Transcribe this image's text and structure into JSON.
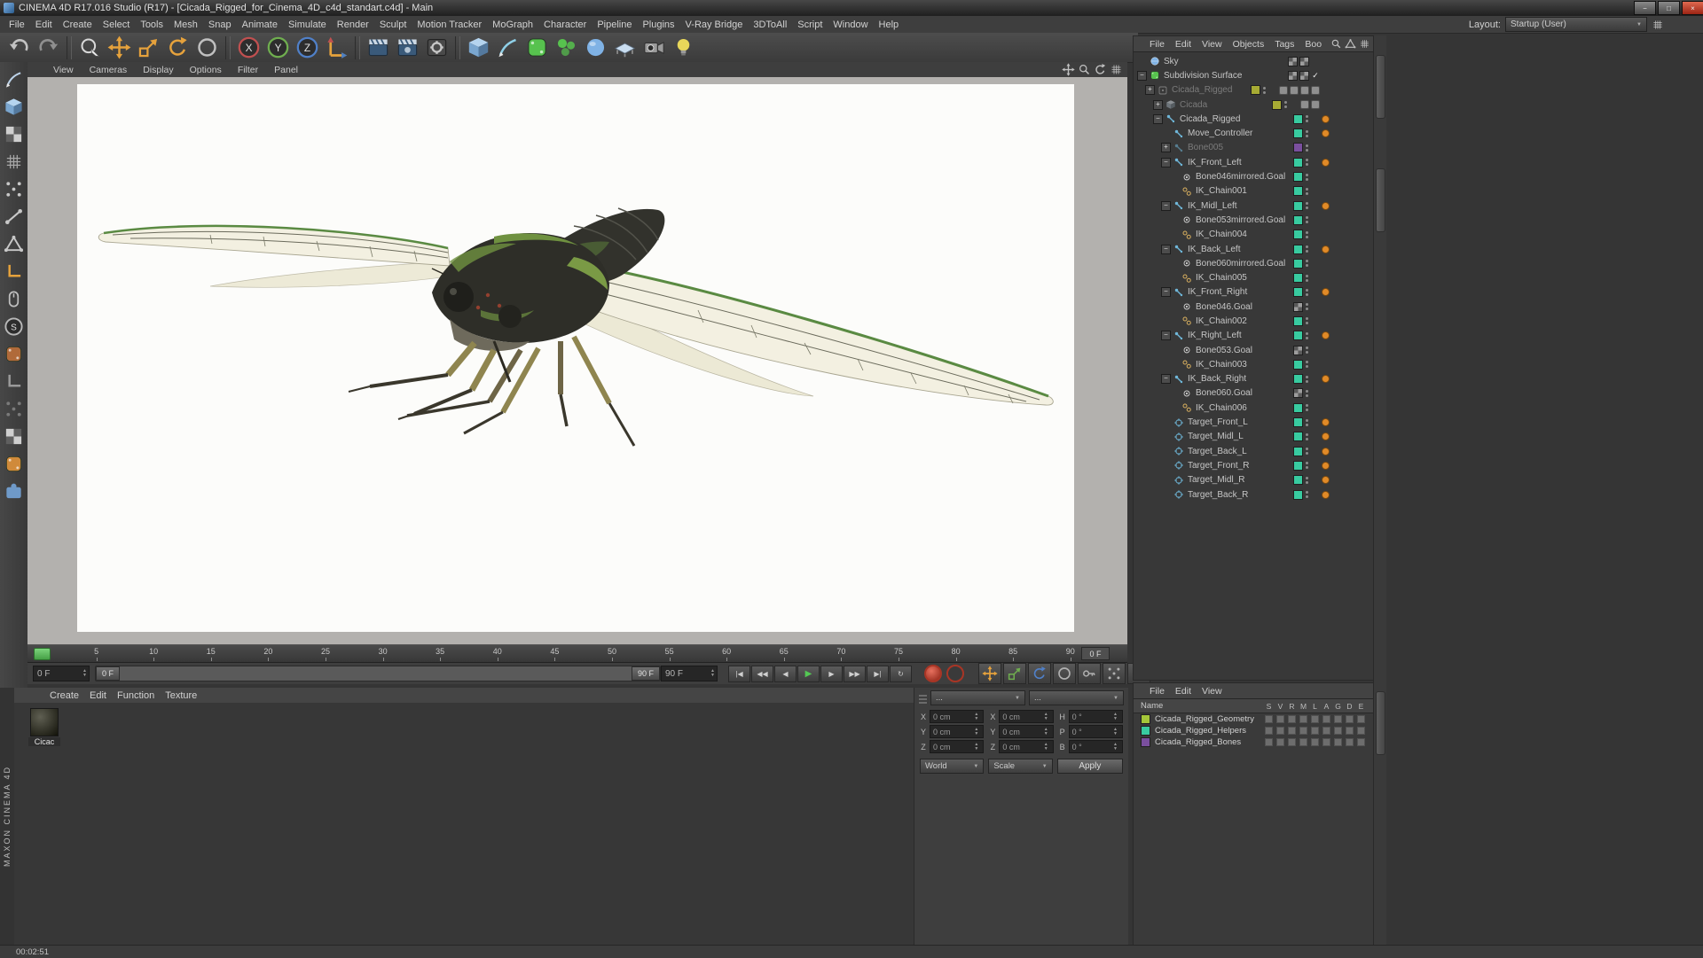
{
  "glyphs": {
    "up": "▲",
    "down": "▼",
    "dropdown": "▼"
  },
  "titlebar": {
    "title": "CINEMA 4D R17.016 Studio (R17) - [Cicada_Rigged_for_Cinema_4D_c4d_standart.c4d] - Main",
    "buttons": [
      {
        "name": "minimize-button",
        "glyph": "−"
      },
      {
        "name": "maximize-button",
        "glyph": "□"
      },
      {
        "name": "close-button",
        "glyph": "×"
      }
    ]
  },
  "menubar": {
    "items": [
      "File",
      "Edit",
      "Create",
      "Select",
      "Tools",
      "Mesh",
      "Snap",
      "Animate",
      "Simulate",
      "Render",
      "Sculpt",
      "Motion Tracker",
      "MoGraph",
      "Character",
      "Pipeline",
      "Plugins",
      "V-Ray Bridge",
      "3DToAll",
      "Script",
      "Window",
      "Help"
    ],
    "layout_label": "Layout:",
    "layout_value": "Startup (User)"
  },
  "toolbar": {
    "icons": [
      {
        "name": "undo-icon",
        "shape": "undo",
        "color": "#c2c2c2"
      },
      {
        "name": "redo-icon",
        "shape": "redo",
        "color": "#8f8f8f"
      },
      {
        "sep": true
      },
      {
        "name": "live-selection-icon",
        "shape": "select",
        "color": "#d8d8d8"
      },
      {
        "name": "move-tool-icon",
        "shape": "move",
        "color": "#e6a23c"
      },
      {
        "name": "scale-tool-icon",
        "shape": "scale",
        "color": "#e6a23c"
      },
      {
        "name": "rotate-tool-icon",
        "shape": "rotate",
        "color": "#e6a23c"
      },
      {
        "name": "last-tool-icon",
        "shape": "ring",
        "color": "#c0c0c0"
      },
      {
        "sep": true
      },
      {
        "name": "lock-x-axis-icon",
        "shape": "letter",
        "glyph": "X",
        "color": "#c05050"
      },
      {
        "name": "lock-y-axis-icon",
        "shape": "letter",
        "glyph": "Y",
        "color": "#6fae4f"
      },
      {
        "name": "lock-z-axis-icon",
        "shape": "letter",
        "glyph": "Z",
        "color": "#5080c8"
      },
      {
        "name": "coordinate-system-icon",
        "shape": "axes",
        "color": "#e6a23c"
      },
      {
        "sep": true
      },
      {
        "name": "render-view-icon",
        "shape": "clapper",
        "color": "#8fb3d9"
      },
      {
        "name": "render-picture-viewer-icon",
        "shape": "clapper2",
        "color": "#8fb3d9"
      },
      {
        "name": "render-settings-icon",
        "shape": "clapper3",
        "color": "#b0b0b0"
      },
      {
        "sep": true
      },
      {
        "name": "add-cube-icon",
        "shape": "cube",
        "color": "#7fb2e5"
      },
      {
        "name": "freehand-spline-icon",
        "shape": "pen",
        "color": "#8fd0e8"
      },
      {
        "name": "subdivision-surface-icon",
        "shape": "roundsq",
        "color": "#57c24e"
      },
      {
        "name": "mograph-icon",
        "shape": "sphere3",
        "color": "#57c24e"
      },
      {
        "name": "simulate-icon",
        "shape": "sphere",
        "color": "#7fb2e5"
      },
      {
        "name": "floor-icon",
        "shape": "floor",
        "color": "#c9ddf0"
      },
      {
        "name": "camera-icon",
        "shape": "camera",
        "color": "#9a9a9a"
      },
      {
        "name": "light-icon",
        "shape": "bulb",
        "color": "#e8d75a"
      }
    ]
  },
  "left_toolbar": [
    {
      "name": "make-editable-icon",
      "shape": "pen",
      "color": "#bcd2e8"
    },
    {
      "name": "model-mode-icon",
      "shape": "cube",
      "color": "#c8c8c8"
    },
    {
      "name": "texture-mode-icon",
      "shape": "checker",
      "color": "#c8c8c8"
    },
    {
      "name": "workplane-mode-icon",
      "shape": "grid",
      "color": "#a8a8a8"
    },
    {
      "name": "points-mode-icon",
      "shape": "dots",
      "color": "#c8c8c8"
    },
    {
      "name": "edges-mode-icon",
      "shape": "edge",
      "color": "#c8c8c8"
    },
    {
      "name": "polygons-mode-icon",
      "shape": "tri",
      "color": "#c8c8c8"
    },
    {
      "name": "axis-mode-icon",
      "shape": "Lshape",
      "color": "#e6a23c"
    },
    {
      "name": "mouse-input-icon",
      "shape": "mouse",
      "color": "#c0c0c0"
    },
    {
      "name": "snap-icon",
      "shape": "letter",
      "glyph": "S",
      "color": "#b8b8b8"
    },
    {
      "name": "paint-tool-icon",
      "shape": "roundsq",
      "color": "#b06a3a"
    },
    {
      "name": "workplane-lock-icon",
      "shape": "Lshape",
      "color": "#9a9a9a"
    },
    {
      "name": "palette-handle-icon",
      "shape": "dots",
      "color": "#7a7a7a"
    },
    {
      "name": "texture-checker-icon",
      "shape": "checker",
      "color": "#9a9a9a"
    },
    {
      "name": "hair-tool-icon",
      "shape": "roundsq",
      "color": "#d08a3a"
    },
    {
      "name": "python-icon",
      "shape": "puzzle",
      "color": "#6f9ac9"
    }
  ],
  "viewport": {
    "menus": [
      "View",
      "Cameras",
      "Display",
      "Options",
      "Filter",
      "Panel"
    ],
    "nav": [
      {
        "name": "pan-view-icon",
        "shape": "move",
        "color": "#c0c0c0"
      },
      {
        "name": "zoom-view-icon",
        "shape": "magnifier",
        "color": "#c0c0c0"
      },
      {
        "name": "rotate-view-icon",
        "shape": "rotate",
        "color": "#c0c0c0"
      },
      {
        "name": "toggle-view-icon",
        "shape": "grid",
        "color": "#c0c0c0"
      }
    ]
  },
  "object_manager": {
    "menus": [
      "File",
      "Edit",
      "View",
      "Objects",
      "Tags",
      "Boo"
    ],
    "icons": [
      {
        "name": "search-icon",
        "shape": "magnifier",
        "color": "#c0c0c0"
      },
      {
        "name": "filter-icon",
        "shape": "tri",
        "color": "#c0c0c0"
      },
      {
        "name": "panel-menu-icon",
        "shape": "grid",
        "color": "#c0c0c0"
      }
    ],
    "check_glyph": "✓",
    "rows": [
      {
        "label": "Sky",
        "lvl": 0,
        "icon": "sky",
        "sq": "check2"
      },
      {
        "label": "Subdivision Surface",
        "lvl": 0,
        "icon": "sds",
        "exp": "-",
        "sq": "check2",
        "chk": true
      },
      {
        "label": "Cicada_Rigged",
        "lvl": 1,
        "icon": "group",
        "exp": "+",
        "gray": true,
        "sq": "olive",
        "tags": 4
      },
      {
        "label": "Cicada",
        "lvl": 2,
        "icon": "mesh",
        "exp": "+",
        "gray": true,
        "sq": "olive",
        "tags": 2
      },
      {
        "label": "Cicada_Rigged",
        "lvl": 2,
        "icon": "joint",
        "exp": "-",
        "sq": "teal",
        "dot": true
      },
      {
        "label": "Move_Controller",
        "lvl": 3,
        "icon": "joint",
        "sq": "teal",
        "dot": true
      },
      {
        "label": "Bone005",
        "lvl": 3,
        "icon": "joint",
        "exp": "+",
        "gray": true,
        "sq": "purple"
      },
      {
        "label": "IK_Front_Left",
        "lvl": 3,
        "icon": "joint",
        "exp": "-",
        "sq": "teal",
        "dot": true
      },
      {
        "label": "Bone046mirrored.Goal",
        "lvl": 4,
        "icon": "goal",
        "sq": "teal"
      },
      {
        "label": "IK_Chain001",
        "lvl": 4,
        "icon": "ik",
        "sq": "teal"
      },
      {
        "label": "IK_Midl_Left",
        "lvl": 3,
        "icon": "joint",
        "exp": "-",
        "sq": "teal",
        "dot": true
      },
      {
        "label": "Bone053mirrored.Goal",
        "lvl": 4,
        "icon": "goal",
        "sq": "teal"
      },
      {
        "label": "IK_Chain004",
        "lvl": 4,
        "icon": "ik",
        "sq": "teal"
      },
      {
        "label": "IK_Back_Left",
        "lvl": 3,
        "icon": "joint",
        "exp": "-",
        "sq": "teal",
        "dot": true
      },
      {
        "label": "Bone060mirrored.Goal",
        "lvl": 4,
        "icon": "goal",
        "sq": "teal"
      },
      {
        "label": "IK_Chain005",
        "lvl": 4,
        "icon": "ik",
        "sq": "teal"
      },
      {
        "label": "IK_Front_Right",
        "lvl": 3,
        "icon": "joint",
        "exp": "-",
        "sq": "teal",
        "dot": true
      },
      {
        "label": "Bone046.Goal",
        "lvl": 4,
        "icon": "goal",
        "sq": "check"
      },
      {
        "label": "IK_Chain002",
        "lvl": 4,
        "icon": "ik",
        "sq": "teal"
      },
      {
        "label": "IK_Right_Left",
        "lvl": 3,
        "icon": "joint",
        "exp": "-",
        "sq": "teal",
        "dot": true
      },
      {
        "label": "Bone053.Goal",
        "lvl": 4,
        "icon": "goal",
        "sq": "check"
      },
      {
        "label": "IK_Chain003",
        "lvl": 4,
        "icon": "ik",
        "sq": "teal"
      },
      {
        "label": "IK_Back_Right",
        "lvl": 3,
        "icon": "joint",
        "exp": "-",
        "sq": "teal",
        "dot": true
      },
      {
        "label": "Bone060.Goal",
        "lvl": 4,
        "icon": "goal",
        "sq": "check"
      },
      {
        "label": "IK_Chain006",
        "lvl": 4,
        "icon": "ik",
        "sq": "teal"
      },
      {
        "label": "Target_Front_L",
        "lvl": 3,
        "icon": "target",
        "sq": "teal",
        "dot": true
      },
      {
        "label": "Target_Midl_L",
        "lvl": 3,
        "icon": "target",
        "sq": "teal",
        "dot": true
      },
      {
        "label": "Target_Back_L",
        "lvl": 3,
        "icon": "target",
        "sq": "teal",
        "dot": true
      },
      {
        "label": "Target_Front_R",
        "lvl": 3,
        "icon": "target",
        "sq": "teal",
        "dot": true
      },
      {
        "label": "Target_Midl_R",
        "lvl": 3,
        "icon": "target",
        "sq": "teal",
        "dot": true
      },
      {
        "label": "Target_Back_R",
        "lvl": 3,
        "icon": "target",
        "sq": "teal",
        "dot": true
      }
    ]
  },
  "timeline": {
    "ticks": [
      5,
      10,
      15,
      20,
      25,
      30,
      35,
      40,
      45,
      50,
      55,
      60,
      65,
      70,
      75,
      80,
      85,
      90
    ],
    "ruler_current": "0 F",
    "frame_field": "0 F",
    "range_start": "0 F",
    "range_end": "90 F",
    "end_field": "90 F",
    "transport": [
      {
        "name": "goto-start-button",
        "glyph": "|◀"
      },
      {
        "name": "prev-key-button",
        "glyph": "◀◀"
      },
      {
        "name": "prev-frame-button",
        "glyph": "◀"
      },
      {
        "name": "play-button",
        "glyph": "▶",
        "accent": true
      },
      {
        "name": "next-frame-button",
        "glyph": "▶"
      },
      {
        "name": "next-key-button",
        "glyph": "▶▶"
      },
      {
        "name": "goto-end-button",
        "glyph": "▶|"
      },
      {
        "name": "loop-button",
        "glyph": "↻"
      }
    ],
    "record": [
      {
        "name": "record-keyframe-button"
      },
      {
        "name": "autokey-button"
      }
    ],
    "toggles": [
      {
        "name": "record-position-toggle",
        "shape": "move",
        "color": "#e6a23c"
      },
      {
        "name": "record-scale-toggle",
        "shape": "scale",
        "color": "#6fae4f"
      },
      {
        "name": "record-rotation-toggle",
        "shape": "rotate",
        "color": "#5080c8"
      },
      {
        "name": "record-parameter-toggle",
        "shape": "ring",
        "color": "#b0b0b0"
      },
      {
        "name": "keyframe-selection-toggle",
        "shape": "key",
        "color": "#b0b0b0"
      },
      {
        "name": "pla-toggle",
        "shape": "dots",
        "color": "#b0b0b0"
      },
      {
        "name": "timeline-mode-icon",
        "shape": "grid",
        "color": "#b0b0b0"
      }
    ]
  },
  "materials": {
    "menus": [
      "Create",
      "Edit",
      "Function",
      "Texture"
    ],
    "items": [
      {
        "label": "Cicac"
      }
    ]
  },
  "coordinates": {
    "header1": "...",
    "header2": "...",
    "columns": [
      {
        "fields": [
          {
            "label": "X",
            "value": "0 cm"
          },
          {
            "label": "Y",
            "value": "0 cm"
          },
          {
            "label": "Z",
            "value": "0 cm"
          }
        ]
      },
      {
        "fields": [
          {
            "label": "X",
            "value": "0 cm"
          },
          {
            "label": "Y",
            "value": "0 cm"
          },
          {
            "label": "Z",
            "value": "0 cm"
          }
        ]
      },
      {
        "fields": [
          {
            "label": "H",
            "value": "0 °"
          },
          {
            "label": "P",
            "value": "0 °"
          },
          {
            "label": "B",
            "value": "0 °"
          }
        ]
      }
    ],
    "dropdown1": "World",
    "dropdown2": "Scale",
    "apply_label": "Apply"
  },
  "layers": {
    "menus": [
      "File",
      "Edit",
      "View"
    ],
    "name_header": "Name",
    "columns": [
      "S",
      "V",
      "R",
      "M",
      "L",
      "A",
      "G",
      "D",
      "E"
    ],
    "rows": [
      {
        "label": "Cicada_Rigged_Geometry",
        "color": "#a4c639"
      },
      {
        "label": "Cicada_Rigged_Helpers",
        "color": "#38cba0"
      },
      {
        "label": "Cicada_Rigged_Bones",
        "color": "#7a4f9e"
      }
    ]
  },
  "status": {
    "time": "00:02:51",
    "brand": "MAXON CINEMA 4D"
  }
}
